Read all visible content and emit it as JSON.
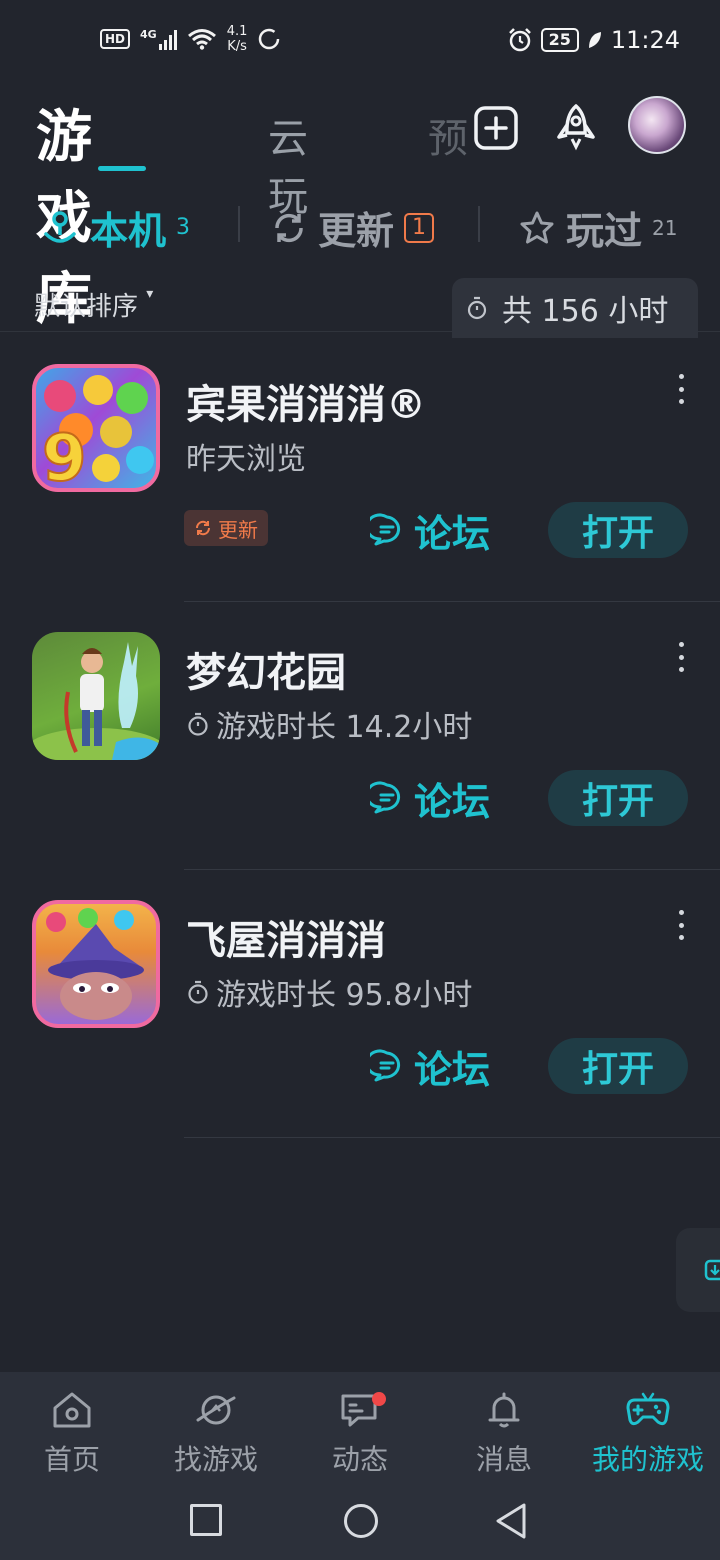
{
  "status_bar": {
    "hd": "HD",
    "network": "4G",
    "speed_value": "4.1",
    "speed_unit": "K/s",
    "battery": "25",
    "time": "11:24"
  },
  "header": {
    "tabs": [
      {
        "label": "游戏库",
        "active": true
      },
      {
        "label": "云玩",
        "active": false
      },
      {
        "label": "预",
        "active": false
      }
    ]
  },
  "subtabs": [
    {
      "label": "本机",
      "count": "3",
      "icon": "local-device-icon",
      "active": true
    },
    {
      "label": "更新",
      "count": "1",
      "icon": "refresh-icon",
      "active": false
    },
    {
      "label": "玩过",
      "count": "21",
      "icon": "star-icon",
      "active": false
    }
  ],
  "sort": {
    "label": "默认排序",
    "total_label": "共 156 小时"
  },
  "games": [
    {
      "name": "宾果消消消®",
      "subtitle": "昨天浏览",
      "show_timer": false,
      "update_tag": "更新",
      "forum_label": "论坛",
      "open_label": "打开"
    },
    {
      "name": "梦幻花园",
      "subtitle": "游戏时长 14.2小时",
      "show_timer": true,
      "update_tag": "",
      "forum_label": "论坛",
      "open_label": "打开"
    },
    {
      "name": "飞屋消消消",
      "subtitle": "游戏时长 95.8小时",
      "show_timer": true,
      "update_tag": "",
      "forum_label": "论坛",
      "open_label": "打开"
    }
  ],
  "bottom_nav": [
    {
      "label": "首页",
      "icon": "home-icon",
      "active": false
    },
    {
      "label": "找游戏",
      "icon": "planet-icon",
      "active": false
    },
    {
      "label": "动态",
      "icon": "feed-icon",
      "active": false,
      "dot": true
    },
    {
      "label": "消息",
      "icon": "bell-icon",
      "active": false
    },
    {
      "label": "我的游戏",
      "icon": "gamepad-icon",
      "active": true
    }
  ],
  "colors": {
    "background": "#22252d",
    "accent": "#1fc2cf",
    "update": "#f07a4a",
    "open_button_bg": "#1f3c45"
  }
}
